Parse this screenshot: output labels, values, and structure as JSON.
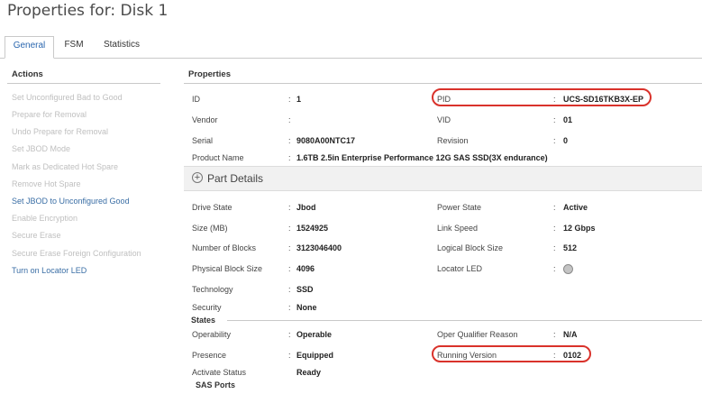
{
  "window": {
    "title": "Properties for: Disk 1"
  },
  "tabs": [
    {
      "label": "General",
      "active": true
    },
    {
      "label": "FSM",
      "active": false
    },
    {
      "label": "Statistics",
      "active": false
    }
  ],
  "actions": {
    "heading": "Actions",
    "items": [
      {
        "label": "Set Unconfigured Bad to Good",
        "enabled": false
      },
      {
        "label": "Prepare for Removal",
        "enabled": false
      },
      {
        "label": "Undo Prepare for Removal",
        "enabled": false
      },
      {
        "label": "Set JBOD Mode",
        "enabled": false
      },
      {
        "label": "Mark as Dedicated Hot Spare",
        "enabled": false
      },
      {
        "label": "Remove Hot Spare",
        "enabled": false
      },
      {
        "label": "Set JBOD to Unconfigured Good",
        "enabled": true
      },
      {
        "label": "Enable Encryption",
        "enabled": false
      },
      {
        "label": "Secure Erase",
        "enabled": false
      },
      {
        "label": "Secure Erase Foreign Configuration",
        "enabled": false
      },
      {
        "label": "Turn on Locator LED",
        "enabled": true
      }
    ]
  },
  "properties": {
    "heading": "Properties",
    "colon": ":",
    "id": {
      "label": "ID",
      "value": "1"
    },
    "pid": {
      "label": "PID",
      "value": "UCS-SD16TKB3X-EP"
    },
    "vendor": {
      "label": "Vendor",
      "value": ""
    },
    "vid": {
      "label": "VID",
      "value": "01"
    },
    "serial": {
      "label": "Serial",
      "value": "9080A00NTC17"
    },
    "revision": {
      "label": "Revision",
      "value": "0"
    },
    "product_name": {
      "label": "Product Name",
      "value": "1.6TB 2.5in Enterprise Performance 12G SAS SSD(3X endurance)"
    },
    "part_details": {
      "label": "Part Details",
      "icon": "plus-circle-icon"
    },
    "drive_state": {
      "label": "Drive State",
      "value": "Jbod"
    },
    "power_state": {
      "label": "Power State",
      "value": "Active"
    },
    "size": {
      "label": "Size (MB)",
      "value": "1524925"
    },
    "link_speed": {
      "label": "Link Speed",
      "value": "12 Gbps"
    },
    "blocks": {
      "label": "Number of Blocks",
      "value": "3123046400"
    },
    "logical_block_size": {
      "label": "Logical Block Size",
      "value": "512"
    },
    "physical_block_size": {
      "label": "Physical Block Size",
      "value": "4096"
    },
    "locator_led": {
      "label": "Locator LED",
      "icon": "led-off-icon",
      "color": "#c4c4c4"
    },
    "technology": {
      "label": "Technology",
      "value": "SSD"
    },
    "security": {
      "label": "Security",
      "value": "None"
    }
  },
  "states": {
    "heading": "States",
    "operability": {
      "label": "Operability",
      "value": "Operable"
    },
    "oper_qualifier": {
      "label": "Oper Qualifier Reason",
      "value": "N/A"
    },
    "presence": {
      "label": "Presence",
      "value": "Equipped"
    },
    "running_version": {
      "label": "Running Version",
      "value": "0102"
    },
    "activate_status": {
      "label": "Activate Status",
      "value": "Ready"
    },
    "sas_ports": {
      "label": "SAS Ports"
    }
  },
  "colors": {
    "highlight": "#d9322b",
    "link": "#3a6ea5",
    "disabled": "#bfbfbf"
  }
}
